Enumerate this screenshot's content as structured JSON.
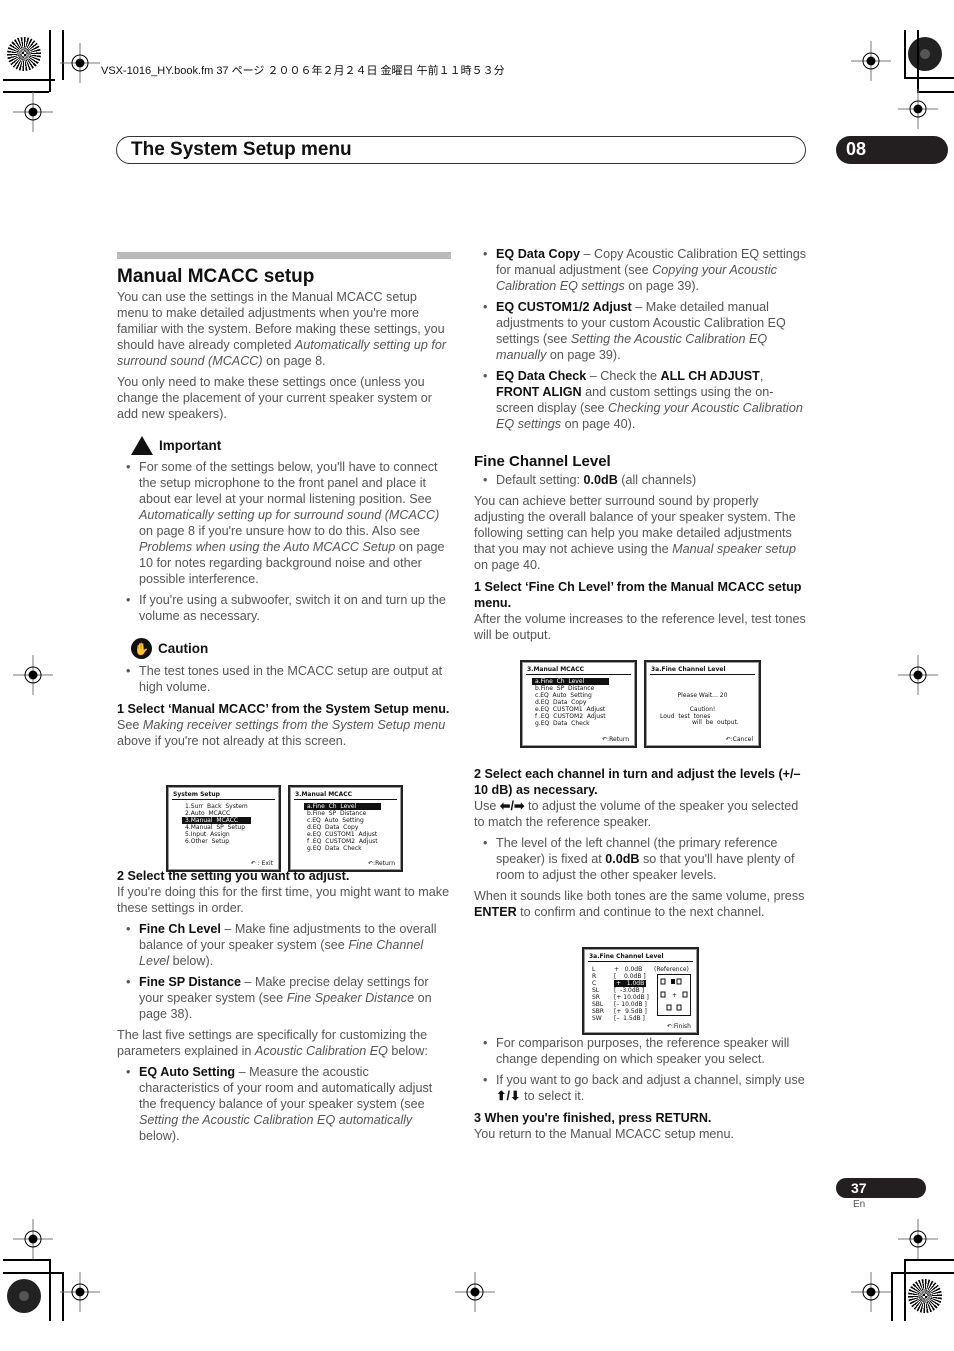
{
  "book_info": "VSX-1016_HY.book.fm 37 ページ ２００６年２月２４日 金曜日 午前１１時５３分",
  "header": {
    "title": "The System Setup menu",
    "chapter": "08"
  },
  "footer": {
    "page_number": "37",
    "language": "En"
  },
  "left": {
    "section_title": "Manual MCACC setup",
    "intro_p1_a": "You can use the settings in the Manual MCACC setup menu to make detailed adjustments when you're more familiar with the system. Before making these settings, you should have already completed ",
    "intro_p1_i": "Automatically setting up for surround sound (MCACC)",
    "intro_p1_b": " on page 8.",
    "intro_p2": "You only need to make these settings once (unless you change the placement of your current speaker system or add new speakers).",
    "important": {
      "label": "Important",
      "items": [
        {
          "a": "For some of the settings below, you'll have to connect the setup microphone to the front panel and place it about ear level at your normal listening position. See ",
          "i1": "Automatically setting up for surround sound (MCACC)",
          "b": " on page 8 if you're unsure how to do this. Also see ",
          "i2": "Problems when using the Auto MCACC Setup",
          "c": " on page 10 for notes regarding background noise and other possible interference."
        },
        {
          "a": "If you're using a subwoofer, switch it on and turn up the volume as necessary."
        }
      ]
    },
    "caution": {
      "label": "Caution",
      "items": [
        "The test tones used in the MCACC setup are output at high volume."
      ]
    },
    "step1": {
      "heading": "1   Select ‘Manual MCACC’ from the System Setup menu.",
      "text_a": "See ",
      "text_i": "Making receiver settings from the System Setup menu",
      "text_b": " above if you're not already at this screen."
    },
    "osd_system_setup": {
      "title": "System  Setup",
      "items": [
        "1.Surr  Back  System",
        "2.Auto  MCACC",
        "3.Manual  MCACC",
        "4.Manual  SP  Setup",
        "5.Input  Assign",
        "6.Other  Setup"
      ],
      "selected_index": 2,
      "footer": "↶ : Exit"
    },
    "osd_manual_mcacc": {
      "title": "3.Manual  MCACC",
      "items": [
        "a.Fine  Ch  Level",
        "b.Fine  SP  Distance",
        "c.EQ  Auto  Setting",
        "d.EQ  Data  Copy",
        "e.EQ  CUSTOM1  Adjust",
        "f .EQ  CUSTOM2  Adjust",
        "g.EQ  Data  Check"
      ],
      "selected_index": 0,
      "footer": "↶:Return"
    },
    "step2": {
      "heading": "2   Select the setting you want to adjust.",
      "text": "If you're doing this for the first time, you might want to make these settings in order."
    },
    "step2_items": [
      {
        "b": "Fine Ch Level",
        "a": " – Make fine adjustments to the overall balance of your speaker system (see ",
        "i": "Fine Channel Level",
        "c": " below)."
      },
      {
        "b": "Fine SP Distance",
        "a": " – Make precise delay settings for your speaker system (see ",
        "i": "Fine Speaker Distance",
        "c": " on page 38)."
      }
    ],
    "last_five_a": "The last five settings are specifically for customizing the parameters explained in ",
    "last_five_i": "Acoustic Calibration EQ",
    "last_five_b": " below:",
    "eq_items": [
      {
        "b": "EQ Auto Setting",
        "a": " – Measure the acoustic characteristics of your room and automatically adjust the frequency balance of your speaker system (see ",
        "i": "Setting the Acoustic Calibration EQ automatically",
        "c": " below)."
      }
    ]
  },
  "right": {
    "eq_items": [
      {
        "b": "EQ Data Copy",
        "a": " – Copy Acoustic Calibration EQ settings for manual adjustment (see ",
        "i": "Copying your Acoustic Calibration EQ settings",
        "c": " on page 39)."
      },
      {
        "b": "EQ CUSTOM1/2 Adjust",
        "a": " – Make detailed manual adjustments to your custom Acoustic Calibration EQ settings (see ",
        "i": "Setting the Acoustic Calibration EQ manually",
        "c": " on page 39)."
      },
      {
        "b": "EQ Data Check",
        "a": " – Check the ",
        "b2": "ALL CH ADJUST",
        "a2": ", ",
        "b3": "FRONT ALIGN",
        "a3": " and custom settings using the on-screen display (see ",
        "i": "Checking your Acoustic Calibration EQ settings",
        "c": " on page 40)."
      }
    ],
    "fcl_title": "Fine Channel Level",
    "default_a": "Default setting: ",
    "default_b": "0.0dB",
    "default_c": " (all channels)",
    "fcl_p_a": "You can achieve better surround sound by properly adjusting the overall balance of your speaker system. The following setting can help you make detailed adjustments that you may not achieve using the ",
    "fcl_p_i": "Manual speaker setup",
    "fcl_p_b": " on page 40.",
    "step1": {
      "heading": "1   Select ‘Fine Ch Level’ from the Manual MCACC setup menu.",
      "text": "After the volume increases to the reference level, test tones will be output."
    },
    "osd_manual_mcacc": {
      "title": "3.Manual  MCACC",
      "items": [
        "a.Fine  Ch  Level",
        "b.Fine  SP  Distance",
        "c.EQ  Auto  Setting",
        "d.EQ  Data  Copy",
        "e.EQ  CUSTOM1  Adjust",
        "f .EQ  CUSTOM2  Adjust",
        "g.EQ  Data  Check"
      ],
      "footer": "↶:Return"
    },
    "osd_wait": {
      "title": "3a.Fine  Channel  Level",
      "wait": "Please  Wait...   20",
      "caution1": "Caution!",
      "caution2": "Loud  test  tones",
      "caution3": "will  be  output.",
      "footer": "↶:Cancel"
    },
    "step2": {
      "heading_a": "2   Select each channel in turn and adjust the levels (",
      "heading_b": "+/– 10 dB",
      "heading_c": ") as necessary.",
      "text_a": "Use ",
      "text_arrows": "⬅/➡",
      "text_b": " to adjust the volume of the speaker you selected to match the reference speaker."
    },
    "step2_item_a": "The level of the left channel (the primary reference speaker) is fixed at ",
    "step2_item_b": "0.0dB",
    "step2_item_c": " so that you'll have plenty of room to adjust the other speaker levels.",
    "confirm_a": "When it sounds like both tones are the same volume, press ",
    "confirm_b": "ENTER",
    "confirm_c": " to confirm and continue to the next channel.",
    "osd_levels": {
      "title": "3a.Fine  Channel  Level",
      "reference_label": "(Reference)",
      "channels": [
        {
          "ch": "L",
          "val": "+   0.0dB"
        },
        {
          "ch": "R",
          "val": "[    0.0dB ]"
        },
        {
          "ch": "C",
          "val": "+   1.0dB"
        },
        {
          "ch": "SL",
          "val": "[  -3.0dB ]"
        },
        {
          "ch": "SR",
          "val": "[+ 10.0dB ]"
        },
        {
          "ch": "SBL",
          "val": "[– 10.0dB ]"
        },
        {
          "ch": "SBR",
          "val": "[+  9.5dB ]"
        },
        {
          "ch": "SW",
          "val": "[–  1.5dB ]"
        }
      ],
      "selected_index": 2,
      "footer": "↶:Finish"
    },
    "compare_note": "For comparison purposes, the reference speaker will change depending on which speaker you select.",
    "go_back_a": "If you want to go back and adjust a channel, simply use ",
    "go_back_arrows": "⬆/⬇",
    "go_back_b": " to select it.",
    "step3": {
      "heading": "3   When you're finished, press RETURN.",
      "text": "You return to the Manual MCACC setup menu."
    }
  }
}
